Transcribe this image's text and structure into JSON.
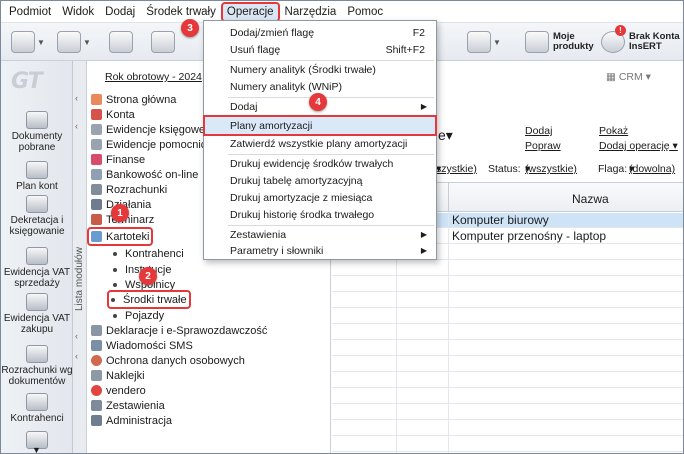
{
  "menubar": {
    "items": [
      "Podmiot",
      "Widok",
      "Dodaj",
      "Środek trwały",
      "Operacje",
      "Narzędzia",
      "Pomoc"
    ]
  },
  "toolbar": {
    "moje_produkty": "Moje\nprodukty",
    "brak_konta": "Brak Konta\nInsERT"
  },
  "quick_panel": {
    "items": [
      "Dokumenty pobrane",
      "Plan kont",
      "Dekretacja i księgowanie",
      "Ewidencja VAT sprzedaży",
      "Ewidencja VAT zakupu",
      "Rozrachunki wg dokumentów",
      "Kontrahenci"
    ]
  },
  "side_tab": {
    "label": "Lista modułów"
  },
  "rok_obrotowy": "Rok obrotowy - 2024",
  "crm_label": "CRM",
  "tree": {
    "items": [
      {
        "label": "Strona główna"
      },
      {
        "label": "Konta"
      },
      {
        "label": "Ewidencje księgowe"
      },
      {
        "label": "Ewidencje pomocnicze"
      },
      {
        "label": "Finanse"
      },
      {
        "label": "Bankowość on-line"
      },
      {
        "label": "Rozrachunki"
      },
      {
        "label": "Działania"
      },
      {
        "label": "Terminarz"
      },
      {
        "label": "Kartoteki"
      }
    ],
    "sub_items": [
      "Kontrahenci",
      "Instytucje",
      "Wspólnicy",
      "Środki trwałe",
      "Pojazdy"
    ],
    "bottom_items": [
      "Deklaracje i e-Sprawozdawczość",
      "Wiadomości SMS",
      "Ochrona danych osobowych",
      "Naklejki",
      "vendero",
      "Zestawienia",
      "Administracja"
    ]
  },
  "content": {
    "links": {
      "dodaj": "Dodaj",
      "popraw": "Popraw",
      "pokaz": "Pokaż",
      "dodaj_operacje": "Dodaj operację"
    },
    "filter": {
      "first": "szystkie)",
      "status_label": "Status:",
      "status_value": "(wszystkie)",
      "flaga_label": "Flaga:",
      "flaga_value": "(dowolna)"
    },
    "column_name": "Nazwa",
    "rows": [
      "Komputer biurowy",
      "Komputer przenośny - laptop"
    ]
  },
  "dropdown": {
    "items": [
      {
        "label": "Dodaj/zmień flagę",
        "shortcut": "F2"
      },
      {
        "label": "Usuń flagę",
        "shortcut": "Shift+F2"
      },
      {
        "label": "Numery analityk (Środki trwałe)"
      },
      {
        "label": "Numery analityk (WNiP)"
      },
      {
        "label": "Dodaj"
      },
      {
        "label": "Plany amortyzacji"
      },
      {
        "label": "Zatwierdź wszystkie plany amortyzacji"
      },
      {
        "label": "Drukuj ewidencję środków trwałych"
      },
      {
        "label": "Drukuj tabelę amortyzacyjną"
      },
      {
        "label": "Drukuj amortyzacje z miesiąca"
      },
      {
        "label": "Drukuj historię środka trwałego"
      },
      {
        "label": "Zestawienia"
      },
      {
        "label": "Parametry i słowniki"
      }
    ]
  },
  "badges": [
    "1",
    "2",
    "3",
    "4"
  ],
  "colors": {
    "accent": "#e5383b",
    "selection": "#cfe3f7",
    "menu_hover": "#dbe8f8"
  }
}
